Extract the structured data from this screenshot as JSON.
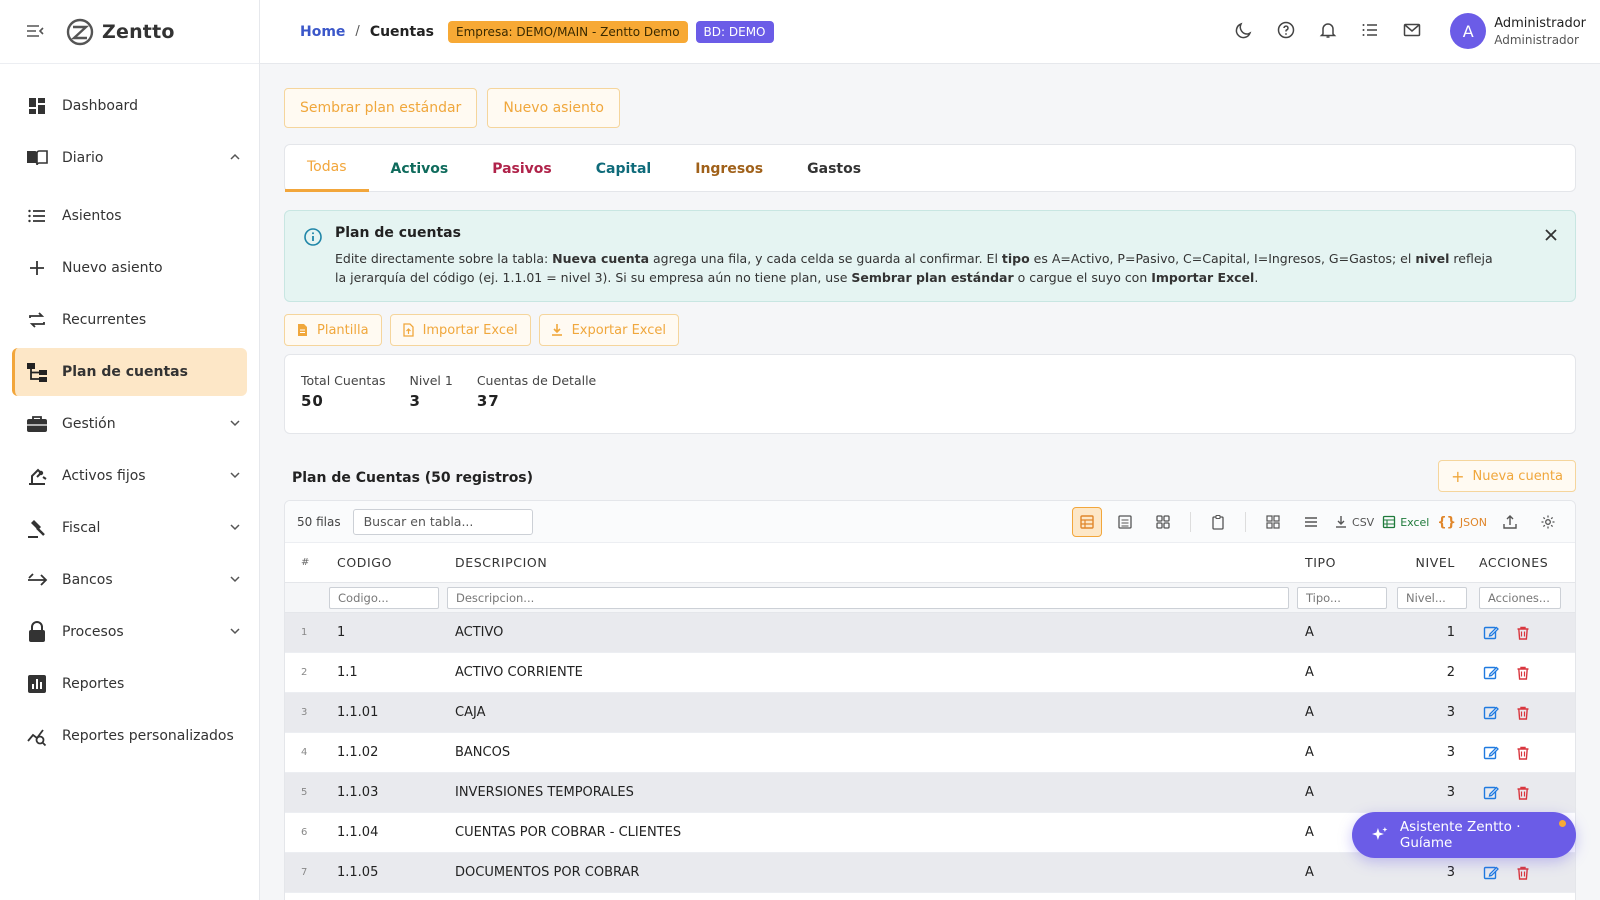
{
  "brand": {
    "name": "Zentto"
  },
  "sidebar": {
    "items": [
      {
        "label": "Dashboard",
        "icon": "dashboard-icon"
      },
      {
        "label": "Diario",
        "icon": "book-icon",
        "expanded": true
      },
      {
        "label": "Asientos",
        "icon": "list-icon"
      },
      {
        "label": "Nuevo asiento",
        "icon": "plus-icon"
      },
      {
        "label": "Recurrentes",
        "icon": "repeat-icon"
      },
      {
        "label": "Plan de cuentas",
        "icon": "tree-icon",
        "active": true
      },
      {
        "label": "Gestión",
        "icon": "briefcase-icon"
      },
      {
        "label": "Activos fijos",
        "icon": "machine-icon"
      },
      {
        "label": "Fiscal",
        "icon": "gavel-icon"
      },
      {
        "label": "Bancos",
        "icon": "transfer-icon"
      },
      {
        "label": "Procesos",
        "icon": "lock-icon"
      },
      {
        "label": "Reportes",
        "icon": "chart-icon"
      },
      {
        "label": "Reportes personalizados",
        "icon": "analytics-icon"
      }
    ]
  },
  "topbar": {
    "breadcrumb_home": "Home",
    "breadcrumb_sep": "/",
    "breadcrumb_current": "Cuentas",
    "badge_empresa": "Empresa: DEMO/MAIN - Zentto Demo",
    "badge_bd": "BD: DEMO",
    "user_initial": "A",
    "user_name": "Administrador",
    "user_role": "Administrador"
  },
  "actions": {
    "seed_button": "Sembrar plan estándar",
    "new_entry_button": "Nuevo asiento"
  },
  "tabs": [
    {
      "label": "Todas",
      "color": "#f2a63b"
    },
    {
      "label": "Activos",
      "color": "#0f6b5c"
    },
    {
      "label": "Pasivos",
      "color": "#b0234a"
    },
    {
      "label": "Capital",
      "color": "#0f6b7a"
    },
    {
      "label": "Ingresos",
      "color": "#a0611a"
    },
    {
      "label": "Gastos",
      "color": "#333333"
    }
  ],
  "info": {
    "title": "Plan de cuentas",
    "text_1": "Edite directamente sobre la tabla: ",
    "bold_1": "Nueva cuenta",
    "text_2": " agrega una fila, y cada celda se guarda al confirmar. El ",
    "bold_2": "tipo",
    "text_3": " es A=Activo, P=Pasivo, C=Capital, I=Ingresos, G=Gastos; el ",
    "bold_3": "nivel",
    "text_4": " refleja la jerarquía del código (ej. 1.1.01 = nivel 3). Si su empresa aún no tiene plan, use ",
    "bold_4": "Sembrar plan estándar",
    "text_5": " o cargue el suyo con ",
    "bold_5": "Importar Excel",
    "text_6": "."
  },
  "tools": {
    "template": "Plantilla",
    "import": "Importar Excel",
    "export": "Exportar Excel"
  },
  "stats": [
    {
      "label": "Total Cuentas",
      "value": "50"
    },
    {
      "label": "Nivel 1",
      "value": "3"
    },
    {
      "label": "Cuentas de Detalle",
      "value": "37"
    }
  ],
  "table": {
    "title": "Plan de Cuentas (50 registros)",
    "new_button": "Nueva cuenta",
    "rows_label": "50 filas",
    "search_placeholder": "Buscar en tabla...",
    "export_csv": "CSV",
    "export_excel": "Excel",
    "export_json": "JSON",
    "headers": {
      "num": "#",
      "codigo": "CODIGO",
      "descripcion": "DESCRIPCION",
      "tipo": "TIPO",
      "nivel": "NIVEL",
      "acciones": "ACCIONES"
    },
    "filters": {
      "codigo": "Codigo...",
      "descripcion": "Descripcion...",
      "tipo": "Tipo...",
      "nivel": "Nivel...",
      "acciones": "Acciones..."
    },
    "rows": [
      {
        "n": "1",
        "codigo": "1",
        "descripcion": "ACTIVO",
        "tipo": "A",
        "nivel": "1"
      },
      {
        "n": "2",
        "codigo": "1.1",
        "descripcion": "ACTIVO CORRIENTE",
        "tipo": "A",
        "nivel": "2"
      },
      {
        "n": "3",
        "codigo": "1.1.01",
        "descripcion": "CAJA",
        "tipo": "A",
        "nivel": "3"
      },
      {
        "n": "4",
        "codigo": "1.1.02",
        "descripcion": "BANCOS",
        "tipo": "A",
        "nivel": "3"
      },
      {
        "n": "5",
        "codigo": "1.1.03",
        "descripcion": "INVERSIONES TEMPORALES",
        "tipo": "A",
        "nivel": "3"
      },
      {
        "n": "6",
        "codigo": "1.1.04",
        "descripcion": "CUENTAS POR COBRAR - CLIENTES",
        "tipo": "A",
        "nivel": "3"
      },
      {
        "n": "7",
        "codigo": "1.1.05",
        "descripcion": "DOCUMENTOS POR COBRAR",
        "tipo": "A",
        "nivel": "3"
      }
    ]
  },
  "assistant": {
    "label": "Asistente Zentto · Guíame"
  },
  "colors": {
    "accent": "#f2a63b",
    "primary": "#6b5ce7",
    "link": "#3b57c9",
    "edit": "#1f7ae0",
    "delete": "#d9363e"
  }
}
